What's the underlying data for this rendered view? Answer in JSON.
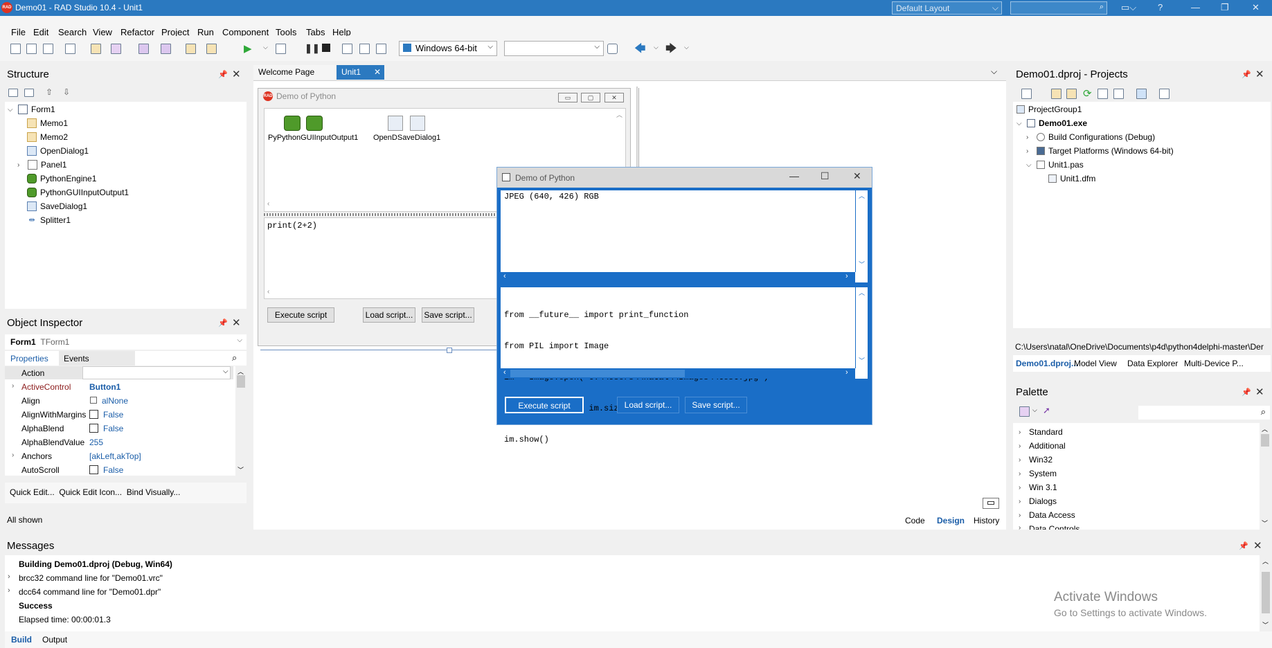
{
  "titlebar": {
    "title": "Demo01 - RAD Studio 10.4 - Unit1",
    "logo_text": "RAD",
    "layout": "Default Layout"
  },
  "menu": [
    "File",
    "Edit",
    "Search",
    "View",
    "Refactor",
    "Project",
    "Run",
    "Component",
    "Tools",
    "Tabs",
    "Help"
  ],
  "toolbar": {
    "platform": "Windows 64-bit",
    "config": ""
  },
  "structure": {
    "title": "Structure",
    "items": [
      {
        "label": "Form1",
        "icon": "form-icon"
      },
      {
        "label": "Memo1",
        "icon": "memo-icon"
      },
      {
        "label": "Memo2",
        "icon": "memo-icon"
      },
      {
        "label": "OpenDialog1",
        "icon": "dialog-icon"
      },
      {
        "label": "Panel1",
        "icon": "panel-icon"
      },
      {
        "label": "PythonEngine1",
        "icon": "python-icon"
      },
      {
        "label": "PythonGUIInputOutput1",
        "icon": "python-icon"
      },
      {
        "label": "SaveDialog1",
        "icon": "dialog-icon"
      },
      {
        "label": "Splitter1",
        "icon": "splitter-icon"
      }
    ]
  },
  "inspector": {
    "title": "Object Inspector",
    "object": "Form1",
    "object_type": "TForm1",
    "tabs": [
      "Properties",
      "Events"
    ],
    "rows": [
      {
        "name": "Action",
        "value": ""
      },
      {
        "name": "ActiveControl",
        "value": "Button1"
      },
      {
        "name": "Align",
        "value": "alNone"
      },
      {
        "name": "AlignWithMargins",
        "value": "False"
      },
      {
        "name": "AlphaBlend",
        "value": "False"
      },
      {
        "name": "AlphaBlendValue",
        "value": "255"
      },
      {
        "name": "Anchors",
        "value": "[akLeft,akTop]"
      },
      {
        "name": "AutoScroll",
        "value": "False"
      }
    ],
    "actions": "Quick Edit...  Quick Edit Icon...  Bind Visually...",
    "status": "All shown"
  },
  "editor": {
    "tabs": [
      "Welcome Page",
      "Unit1"
    ],
    "designer": {
      "title": "Demo of Python",
      "components": [
        "PyPythonGUIInputOutput1",
        "OpenDSaveDialog1"
      ],
      "memo2": "print(2+2)",
      "buttons": [
        "Execute script",
        "Load script...",
        "Save script..."
      ]
    },
    "bottom_tabs": [
      "Code",
      "Design",
      "History"
    ]
  },
  "runwin": {
    "title": "Demo of Python",
    "output": "JPEG (640, 426) RGB",
    "code": [
      "from __future__ import print_function",
      "from PIL import Image",
      "im = Image.open(\"C:\\\\Users\\\\natal\\\\Images\\\\test.jpg\")",
      "print(im.format, im.size, im.mode)",
      "im.show()"
    ],
    "buttons": [
      "Execute script",
      "Load script...",
      "Save script..."
    ]
  },
  "projects": {
    "title": "Demo01.dproj - Projects",
    "items": [
      "ProjectGroup1",
      "Demo01.exe",
      "Build Configurations (Debug)",
      "Target Platforms (Windows 64-bit)",
      "Unit1.pas",
      "Unit1.dfm"
    ],
    "path": "C:\\Users\\natal\\OneDrive\\Documents\\p4d\\python4delphi-master\\Der",
    "tabs": [
      "Demo01.dproj...",
      "Model View",
      "Data Explorer",
      "Multi-Device P..."
    ]
  },
  "palette": {
    "title": "Palette",
    "items": [
      "Standard",
      "Additional",
      "Win32",
      "System",
      "Win 3.1",
      "Dialogs",
      "Data Access",
      "Data Controls"
    ]
  },
  "messages": {
    "title": "Messages",
    "lines": [
      {
        "text": "Building Demo01.dproj (Debug, Win64)",
        "bold": true
      },
      {
        "text": "brcc32 command line for \"Demo01.vrc\"",
        "bold": false
      },
      {
        "text": "dcc64 command line for \"Demo01.dpr\"",
        "bold": false
      },
      {
        "text": "Success",
        "bold": true
      },
      {
        "text": "Elapsed time: 00:00:01.3",
        "bold": false
      }
    ],
    "tabs": [
      "Build",
      "Output"
    ]
  },
  "watermark": {
    "line1": "Activate Windows",
    "line2": "Go to Settings to activate Windows."
  }
}
